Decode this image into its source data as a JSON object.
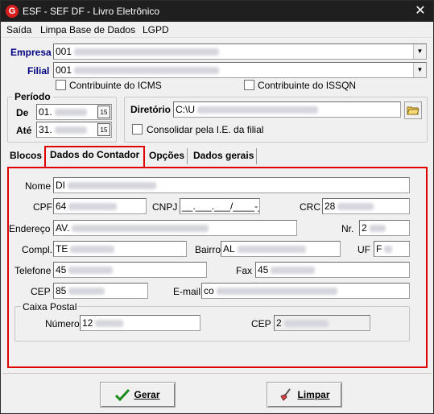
{
  "window": {
    "title": "ESF - SEF DF - Livro Eletrônico"
  },
  "menu": {
    "saida": "Saída",
    "limpar": "Limpa Base de Dados",
    "lgpd": "LGPD"
  },
  "header": {
    "empresa_label": "Empresa",
    "empresa_value": "001",
    "filial_label": "Filial",
    "filial_value": "001",
    "contrib_icms": "Contribuinte do ICMS",
    "contrib_issqn": "Contribuinte do ISSQN"
  },
  "periodo": {
    "legend": "Período",
    "de_label": "De",
    "de_value": "01.",
    "ate_label": "Até",
    "ate_value": "31."
  },
  "diretorio": {
    "label": "Diretório",
    "value": "C:\\U",
    "consolidar": "Consolidar pela I.E. da filial"
  },
  "tabs": [
    "Blocos",
    "Dados do Contador",
    "Opções",
    "Dados gerais"
  ],
  "contador": {
    "nome_label": "Nome",
    "nome_value": "DI",
    "cpf_label": "CPF",
    "cpf_value": "64",
    "cnpj_label": "CNPJ",
    "cnpj_value": "__.___.___/____-__",
    "crc_label": "CRC",
    "crc_value": "28",
    "endereco_label": "Endereço",
    "endereco_value": "AV.",
    "nr_label": "Nr.",
    "nr_value": "2",
    "compl_label": "Compl.",
    "compl_value": "TE",
    "bairro_label": "Bairro",
    "bairro_value": "AL",
    "uf_label": "UF",
    "uf_value": "F",
    "telefone_label": "Telefone",
    "telefone_value": "45",
    "fax_label": "Fax",
    "fax_value": "45",
    "cep_label": "CEP",
    "cep_value": "85",
    "email_label": "E-mail",
    "email_value": "co",
    "caixa_legend": "Caixa Postal",
    "numero_label": "Número",
    "numero_value": "12",
    "cx_cep_label": "CEP",
    "cx_cep_value": "2"
  },
  "buttons": {
    "gerar": "Gerar",
    "limpar": "Limpar"
  }
}
